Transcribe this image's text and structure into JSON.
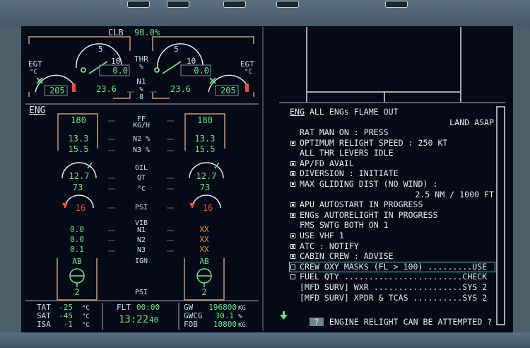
{
  "engine_display": {
    "thrust_mode": "CLB",
    "thrust_limit": "98.0%",
    "thr_label": "THR",
    "thr_unit": "%",
    "n1_label": "N1",
    "n1_unit": "%",
    "n1_eng_number": "8",
    "egt_label": "EGT",
    "egt_unit": "°C",
    "n1_scale_5": "5",
    "n1_scale_10": "10",
    "engines": [
      {
        "thr": "0.0",
        "n1": "23.6",
        "egt": "205",
        "ff": "180",
        "n2": "13.3",
        "n3": "15.5",
        "oil_qt": "12.7",
        "oil_temp": "73",
        "oil_psi": "16",
        "vib_n1": "0.0",
        "vib_n2": "0.0",
        "vib_n3": "0.1",
        "ign": "AB",
        "ign_psi": "2"
      },
      {
        "thr": "0.0",
        "n1": "23.6",
        "egt": "205",
        "ff": "180",
        "n2": "13.3",
        "n3": "15.5",
        "oil_qt": "12.7",
        "oil_temp": "73",
        "oil_psi": "16",
        "vib_n1": "XX",
        "vib_n2": "XX",
        "vib_n3": "XX",
        "ign": "AB",
        "ign_psi": "2"
      }
    ]
  },
  "eng_page": {
    "title": "ENG",
    "labels": {
      "ff": "FF",
      "ff_unit": "KG/H",
      "n2": "N2 %",
      "n3": "N3 %",
      "oil": "OIL",
      "qt": "QT",
      "deg": "°C",
      "psi": "PSI",
      "vib": "VIB",
      "n1": "N1",
      "vn2": "N2",
      "vn3": "N3",
      "ign": "IGN",
      "ign_psi": "PSI"
    }
  },
  "status_bar": {
    "tat_label": "TAT",
    "tat": "-25",
    "sat_label": "SAT",
    "sat": "-45",
    "isa_label": "ISA",
    "isa": "-1",
    "temp_unit": "°C",
    "flt_label": "FLT",
    "flt_time": "00:00",
    "clock": "13:22",
    "clock_sec": "40",
    "gw_label": "GW",
    "gw": "196800",
    "gw_unit": "KG",
    "gwcg_label": "GWCG",
    "gwcg": "30.1",
    "gwcg_unit": "%",
    "fob_label": "FOB",
    "fob": "10800",
    "fob_unit": "KG"
  },
  "ecam": {
    "title_system": "ENG",
    "title": "ALL ENGs FLAME OUT",
    "advisory": "LAND ASAP",
    "items": [
      {
        "text": "RAT MAN ON : PRESS",
        "box": ""
      },
      {
        "text": "OPTIMUM RELIGHT SPEED : 250 KT",
        "box": "done"
      },
      {
        "text": "ALL THR LEVERS IDLE",
        "box": ""
      },
      {
        "text": "AP/FD AVAIL",
        "box": "done"
      },
      {
        "text": "DIVERSION : INITIATE",
        "box": "done"
      },
      {
        "text": "MAX GLIDING DIST (NO WIND) :",
        "box": "done"
      },
      {
        "text": "2.5 NM / 1000 FT",
        "box": "",
        "align": "right"
      },
      {
        "text": "APU AUTOSTART IN PROGRESS",
        "box": "done"
      },
      {
        "text": "ENGs AUTORELIGHT IN PROGRESS",
        "box": "done"
      },
      {
        "text": "FMS SWTG BOTH ON 1",
        "box": ""
      },
      {
        "text": "USE VHF 1",
        "box": "done"
      },
      {
        "text": "ATC : NOTIFY",
        "box": "done"
      },
      {
        "text": "CABIN CREW : ADVISE",
        "box": "done"
      },
      {
        "text": "CREW OXY MASKS (FL > 100) .........USE",
        "box": "open",
        "selected": true
      },
      {
        "text": "FUEL QTY ........................CHECK",
        "box": "open"
      },
      {
        "text": "[MFD SURV] WXR ..................SYS 2",
        "box": ""
      },
      {
        "text": "[MFD SURV] XPDR & TCAS ..........SYS 2",
        "box": ""
      }
    ],
    "query_icon": "?",
    "query": "ENGINE RELIGHT CAN BE ATTEMPTED ?",
    "more_icon": "green-down-arrow"
  },
  "colors": {
    "green": "#6ee38a",
    "cyan": "#c2e4e6",
    "red": "#e8503e",
    "amber": "#e8904a",
    "frame": "#c79c82",
    "select": "#4fd6d6"
  }
}
